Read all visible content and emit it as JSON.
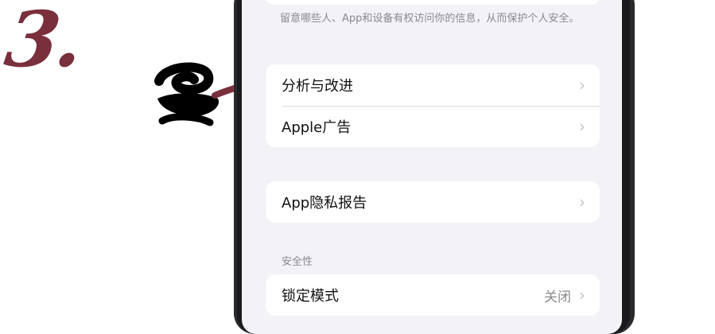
{
  "step_number": "3.",
  "privacy": {
    "footer_note": "留意哪些人、App和设备有权访问你的信息，从而保护个人安全。",
    "group1": [
      {
        "label": "分析与改进",
        "chevron": "›"
      },
      {
        "label": "Apple广告",
        "chevron": "›"
      }
    ],
    "group2": [
      {
        "label": "App隐私报告",
        "chevron": "›"
      }
    ],
    "security_header": "安全性",
    "lockdown": {
      "label": "锁定模式",
      "value": "关闭",
      "chevron": "›"
    }
  },
  "colors": {
    "accent_annotation": "#7a2f3c",
    "screen_background": "#f2f2f7",
    "secondary_text": "#8a8a8e"
  }
}
